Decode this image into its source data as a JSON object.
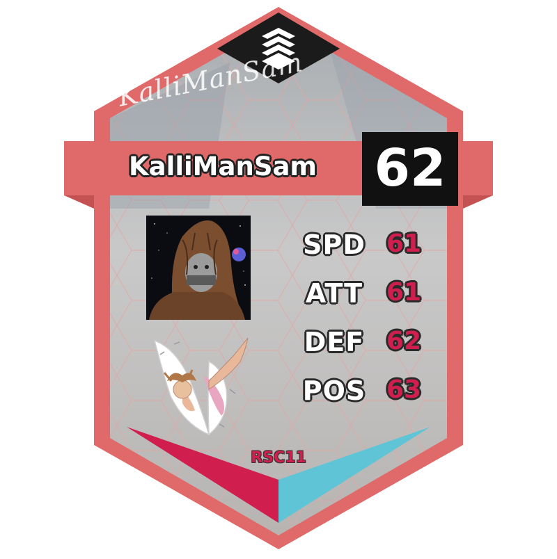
{
  "card": {
    "signature": "KalliManSam",
    "player_name": "KalliManSam",
    "overall_rating": "62",
    "season": "RSC11",
    "colors": {
      "frame": "#e06a6a",
      "card_bg": "#b4b4b4",
      "rating_box": "#111111",
      "stat_value": "#d01f4e",
      "chevron_left": "#d01f4e",
      "chevron_right": "#5ec4d6"
    },
    "logo_icon": "stacked-chevrons-logo-icon",
    "avatar_icon": "hairy-creature-avatar",
    "badge_icon": "falling-angel-badge",
    "stats": [
      {
        "label": "SPD",
        "value": "61"
      },
      {
        "label": "ATT",
        "value": "61"
      },
      {
        "label": "DEF",
        "value": "62"
      },
      {
        "label": "POS",
        "value": "63"
      }
    ]
  }
}
